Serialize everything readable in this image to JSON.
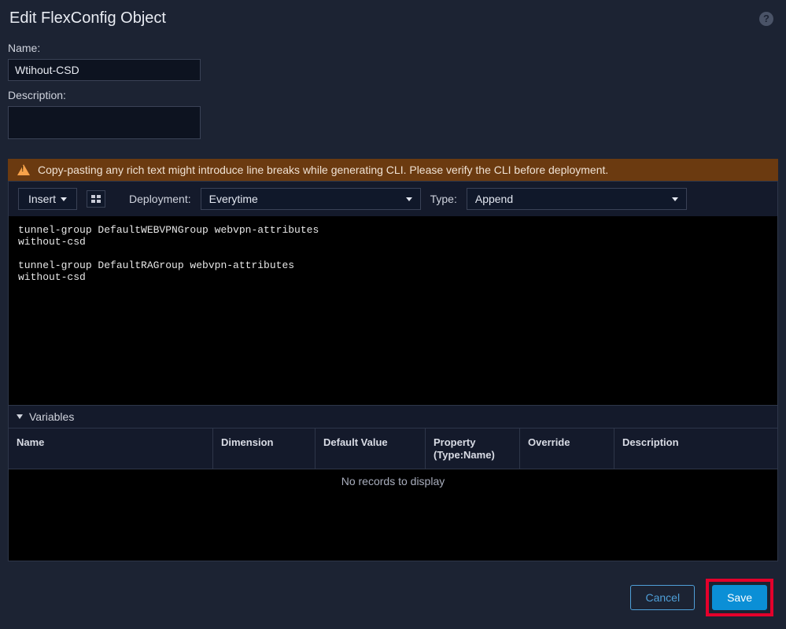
{
  "dialog": {
    "title": "Edit FlexConfig Object"
  },
  "fields": {
    "name_label": "Name:",
    "name_value": "Wtihout-CSD",
    "desc_label": "Description:",
    "desc_value": ""
  },
  "warning": {
    "text": "Copy-pasting any rich text might introduce line breaks while generating CLI. Please verify the CLI before deployment."
  },
  "toolbar": {
    "insert_label": "Insert",
    "deployment_label": "Deployment:",
    "deployment_value": "Everytime",
    "type_label": "Type:",
    "type_value": "Append"
  },
  "editor": {
    "content": "tunnel-group DefaultWEBVPNGroup webvpn-attributes\nwithout-csd\n\ntunnel-group DefaultRAGroup webvpn-attributes\nwithout-csd"
  },
  "variables": {
    "section_label": "Variables",
    "columns": {
      "name": "Name",
      "dimension": "Dimension",
      "default_value": "Default Value",
      "property": "Property\n(Type:Name)",
      "override": "Override",
      "description": "Description"
    },
    "empty_message": "No records to display",
    "rows": []
  },
  "footer": {
    "cancel_label": "Cancel",
    "save_label": "Save"
  }
}
